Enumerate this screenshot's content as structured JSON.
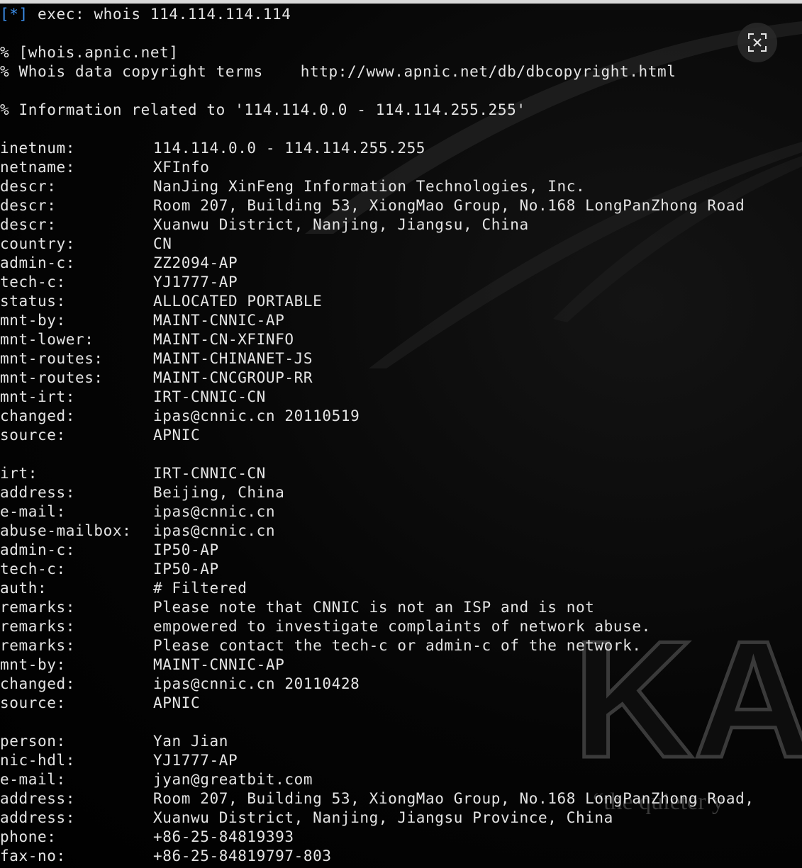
{
  "terminal": {
    "command_marker": "[*]",
    "command": "exec: whois 114.114.114.114",
    "header_lines": [
      "% [whois.apnic.net]",
      "% Whois data copyright terms    http://www.apnic.net/db/dbcopyright.html",
      "% Information related to '114.114.0.0 - 114.114.255.255'"
    ],
    "inetnum_block": [
      {
        "key": "inetnum:",
        "value": "114.114.0.0 - 114.114.255.255"
      },
      {
        "key": "netname:",
        "value": "XFInfo"
      },
      {
        "key": "descr:",
        "value": "NanJing XinFeng Information Technologies, Inc."
      },
      {
        "key": "descr:",
        "value": "Room 207, Building 53, XiongMao Group, No.168 LongPanZhong Road"
      },
      {
        "key": "descr:",
        "value": "Xuanwu District, Nanjing, Jiangsu, China"
      },
      {
        "key": "country:",
        "value": "CN"
      },
      {
        "key": "admin-c:",
        "value": "ZZ2094-AP"
      },
      {
        "key": "tech-c:",
        "value": "YJ1777-AP"
      },
      {
        "key": "status:",
        "value": "ALLOCATED PORTABLE"
      },
      {
        "key": "mnt-by:",
        "value": "MAINT-CNNIC-AP"
      },
      {
        "key": "mnt-lower:",
        "value": "MAINT-CN-XFINFO"
      },
      {
        "key": "mnt-routes:",
        "value": "MAINT-CHINANET-JS"
      },
      {
        "key": "mnt-routes:",
        "value": "MAINT-CNCGROUP-RR"
      },
      {
        "key": "mnt-irt:",
        "value": "IRT-CNNIC-CN"
      },
      {
        "key": "changed:",
        "value": "ipas@cnnic.cn 20110519"
      },
      {
        "key": "source:",
        "value": "APNIC"
      }
    ],
    "irt_block": [
      {
        "key": "irt:",
        "value": "IRT-CNNIC-CN"
      },
      {
        "key": "address:",
        "value": "Beijing, China"
      },
      {
        "key": "e-mail:",
        "value": "ipas@cnnic.cn"
      },
      {
        "key": "abuse-mailbox:",
        "value": "ipas@cnnic.cn"
      },
      {
        "key": "admin-c:",
        "value": "IP50-AP"
      },
      {
        "key": "tech-c:",
        "value": "IP50-AP"
      },
      {
        "key": "auth:",
        "value": "# Filtered"
      },
      {
        "key": "remarks:",
        "value": "Please note that CNNIC is not an ISP and is not"
      },
      {
        "key": "remarks:",
        "value": "empowered to investigate complaints of network abuse."
      },
      {
        "key": "remarks:",
        "value": "Please contact the tech-c or admin-c of the network."
      },
      {
        "key": "mnt-by:",
        "value": "MAINT-CNNIC-AP"
      },
      {
        "key": "changed:",
        "value": "ipas@cnnic.cn 20110428"
      },
      {
        "key": "source:",
        "value": "APNIC"
      }
    ],
    "person_block": [
      {
        "key": "person:",
        "value": "Yan Jian"
      },
      {
        "key": "nic-hdl:",
        "value": "YJ1777-AP"
      },
      {
        "key": "e-mail:",
        "value": "jyan@greatbit.com"
      },
      {
        "key": "address:",
        "value": "Room 207, Building 53, XiongMao Group, No.168 LongPanZhong Road,"
      },
      {
        "key": "address:",
        "value": "Xuanwu District, Nanjing, Jiangsu Province, China"
      },
      {
        "key": "phone:",
        "value": "+86-25-84819393"
      },
      {
        "key": "fax-no:",
        "value": "+86-25-84819797-803"
      }
    ]
  },
  "wallpaper": {
    "logo_text": "KA",
    "quote_text": "“the quieter y"
  },
  "close_button": {
    "icon": "close-icon"
  },
  "colors": {
    "background": "#000000",
    "text": "#e4e4e4",
    "marker": "#3b8eea"
  }
}
